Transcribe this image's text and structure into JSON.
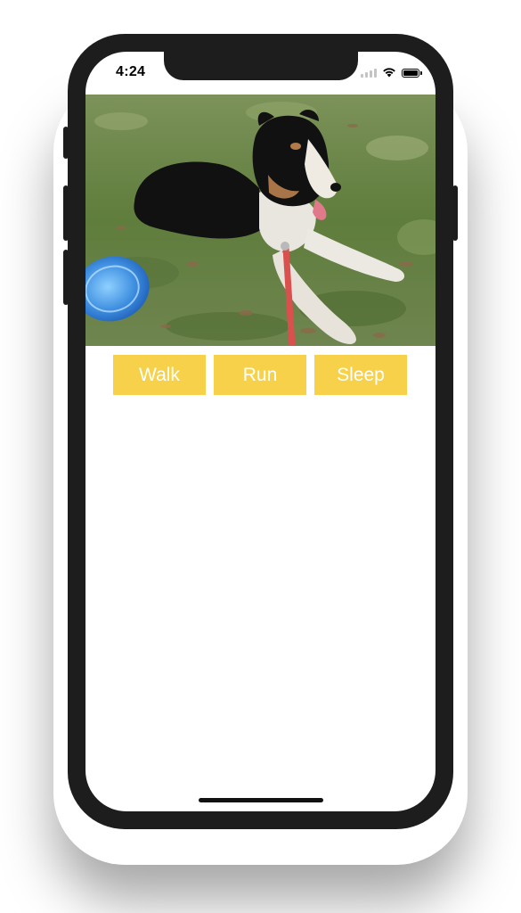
{
  "status_bar": {
    "time": "4:24",
    "icons": [
      "cellular-signal-icon",
      "wifi-icon",
      "battery-icon"
    ]
  },
  "photo": {
    "subject": "dog-photo",
    "accent_colors": {
      "grass": "#5d7a3e",
      "dog_fur": "#111111",
      "frisbee": "#3f8fe0",
      "leash": "#d9504f"
    }
  },
  "actions": [
    {
      "id": "walk",
      "label": "Walk"
    },
    {
      "id": "run",
      "label": "Run"
    },
    {
      "id": "sleep",
      "label": "Sleep"
    }
  ],
  "theme": {
    "button_bg": "#f7d14a",
    "button_text": "#ffffff",
    "phone_frame": "#1d1d1d"
  }
}
